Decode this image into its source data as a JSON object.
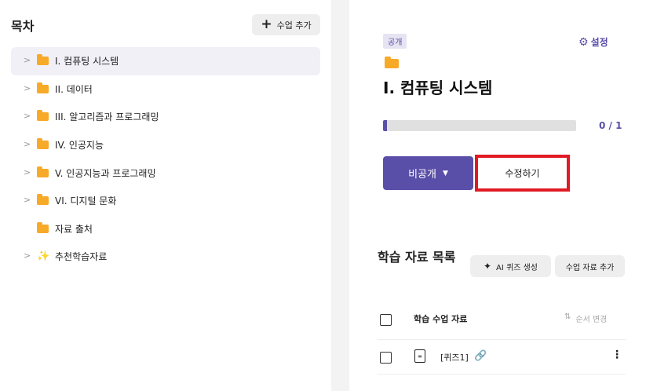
{
  "toc": {
    "title": "목차",
    "add_button": "수업 추가",
    "items": [
      {
        "label": "I. 컴퓨팅 시스템",
        "type": "folder",
        "selected": true
      },
      {
        "label": "II. 데이터",
        "type": "folder"
      },
      {
        "label": "III. 알고리즘과 프로그래밍",
        "type": "folder"
      },
      {
        "label": "IV. 인공지능",
        "type": "folder"
      },
      {
        "label": "V. 인공지능과 프로그래밍",
        "type": "folder"
      },
      {
        "label": "VI. 디지털 문화",
        "type": "folder"
      },
      {
        "label": "자료 출처",
        "type": "folder-noexpand"
      },
      {
        "label": "추천학습자료",
        "type": "wand"
      }
    ]
  },
  "detail": {
    "badge": "공개",
    "settings_label": "설정",
    "title": "I. 컴퓨팅 시스템",
    "progress": {
      "done": 0,
      "total": 1,
      "text": "0 / 1"
    },
    "visibility_button": "비공개",
    "edit_button": "수정하기"
  },
  "materials": {
    "title": "학습 자료 목록",
    "ai_quiz_button": "AI 퀴즈 생성",
    "add_material_button": "수업 자료 추가",
    "header_label": "학습 수업 자료",
    "reorder_label": "순서 변경",
    "rows": [
      {
        "label": "[퀴즈1]"
      }
    ]
  },
  "colors": {
    "accent": "#5a4fa8",
    "folder": "#f7a928",
    "highlight": "#e11a24",
    "link": "#2aa14a"
  }
}
